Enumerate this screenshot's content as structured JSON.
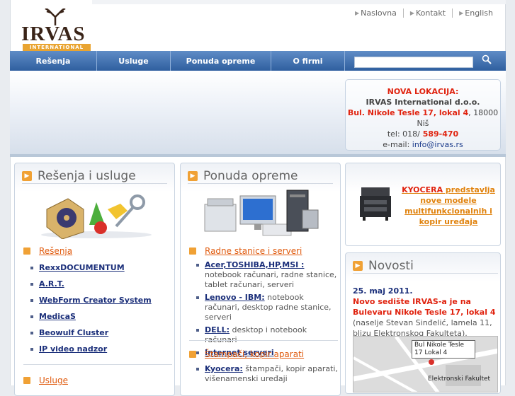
{
  "header": {
    "logo_word": "IRVAS",
    "logo_tagline": "INTERNATIONAL",
    "links": [
      "Naslovna",
      "Kontakt",
      "English"
    ]
  },
  "nav": {
    "items": [
      "Rešenja",
      "Usluge",
      "Ponuda opreme",
      "O firmi"
    ],
    "search_placeholder": ""
  },
  "location": {
    "title": "NOVA LOKACIJA:",
    "company": "IRVAS International d.o.o.",
    "address_red": "Bul. Nikole Tesle 17, lokal 4",
    "address_city": ", 18000 Niš",
    "tel_label": "tel: 018/",
    "tel_red": " 589-470",
    "email_label": "e-mail:",
    "email": " info@irvas.rs"
  },
  "col1": {
    "title": "Rešenja i usluge",
    "sec1": "Rešenja",
    "items": [
      "RexxDOCUMENTUM",
      "A.R.T.",
      "WebForm Creator System",
      "MedicaS",
      "Beowulf Cluster",
      "IP video nadzor"
    ],
    "sec2": "Usluge"
  },
  "col2": {
    "title": "Ponuda opreme",
    "sec1": "Radne stanice i serveri",
    "items": [
      {
        "bold": "Acer,TOSHIBA,HP,MSI :",
        "text": " notebook računari, radne stanice, tablet računari, serveri"
      },
      {
        "bold": "Lenovo - IBM:",
        "text": " notebook računari, desktop radne stanice, serveri"
      },
      {
        "bold": "DELL:",
        "text": " desktop i notebook računari"
      },
      {
        "bold": "Internet serveri",
        "text": ""
      }
    ],
    "sec2": "Štampači, kopir aparati",
    "items2": [
      {
        "bold": "Kyocera:",
        "text": " štampači, kopir aparati, višenamenski uređaji"
      }
    ]
  },
  "promo": {
    "brand": "KYOCERA",
    "text": " predstavlja nove modele multifunkcionalnih i kopir uređaja"
  },
  "news": {
    "title": "Novosti",
    "date": "25. maj 2011.",
    "headline": "Novo sedište IRVAS-a je na Bulevaru Nikole Tesle 17, lokal 4",
    "text": " (naselje Stevan Sinđelić, lamela 11, blizu Elektronskog Fakulteta).",
    "map_label": "Bul Nikole Tesle 17 Lokal 4",
    "map_label2": "Elektronski Fakultet"
  },
  "colors": {
    "accent": "#f0a135",
    "nav": "#2f5f9f",
    "red": "#e0230f"
  }
}
